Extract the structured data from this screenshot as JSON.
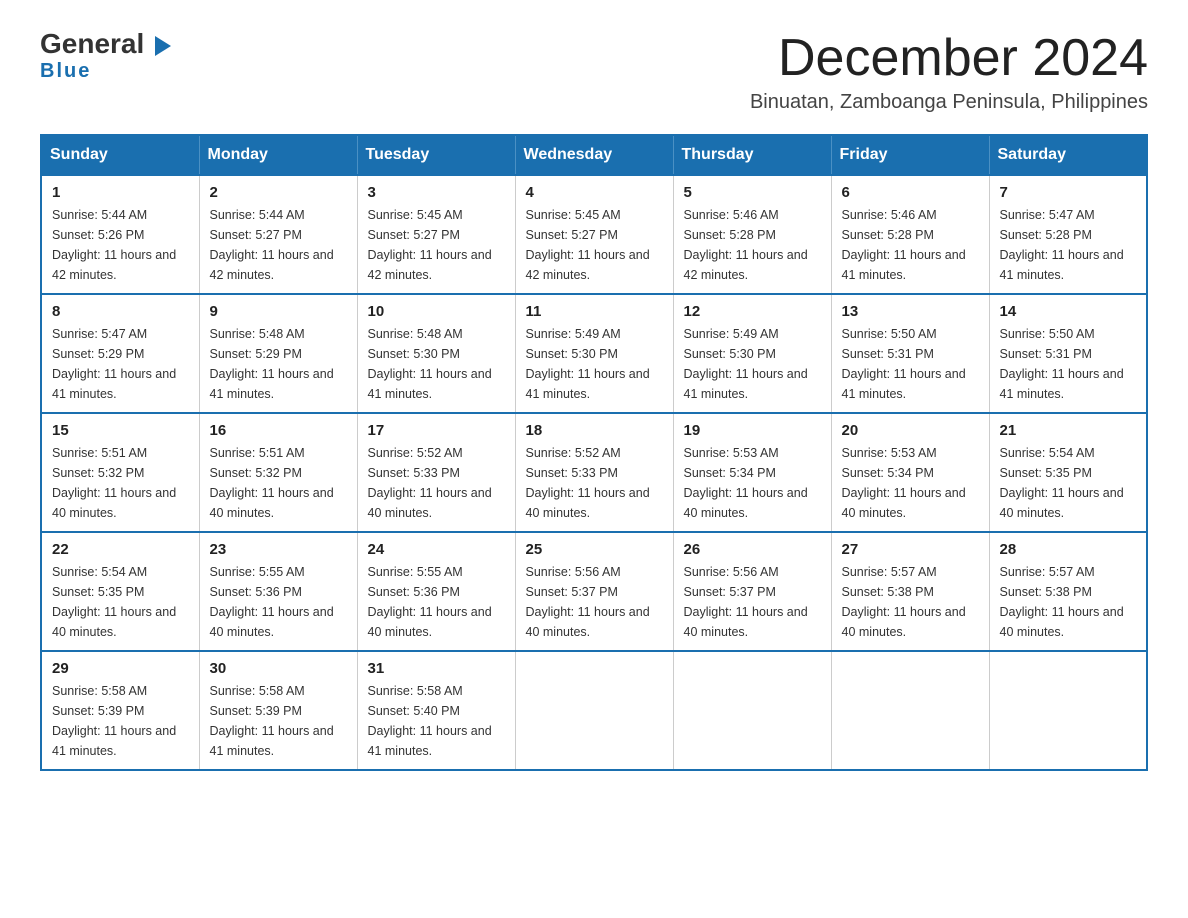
{
  "logo": {
    "general": "General",
    "blue": "Blue",
    "triangle_char": "▶"
  },
  "header": {
    "month_year": "December 2024",
    "location": "Binuatan, Zamboanga Peninsula, Philippines"
  },
  "weekdays": [
    "Sunday",
    "Monday",
    "Tuesday",
    "Wednesday",
    "Thursday",
    "Friday",
    "Saturday"
  ],
  "weeks": [
    [
      {
        "day": "1",
        "sunrise": "5:44 AM",
        "sunset": "5:26 PM",
        "daylight": "11 hours and 42 minutes."
      },
      {
        "day": "2",
        "sunrise": "5:44 AM",
        "sunset": "5:27 PM",
        "daylight": "11 hours and 42 minutes."
      },
      {
        "day": "3",
        "sunrise": "5:45 AM",
        "sunset": "5:27 PM",
        "daylight": "11 hours and 42 minutes."
      },
      {
        "day": "4",
        "sunrise": "5:45 AM",
        "sunset": "5:27 PM",
        "daylight": "11 hours and 42 minutes."
      },
      {
        "day": "5",
        "sunrise": "5:46 AM",
        "sunset": "5:28 PM",
        "daylight": "11 hours and 42 minutes."
      },
      {
        "day": "6",
        "sunrise": "5:46 AM",
        "sunset": "5:28 PM",
        "daylight": "11 hours and 41 minutes."
      },
      {
        "day": "7",
        "sunrise": "5:47 AM",
        "sunset": "5:28 PM",
        "daylight": "11 hours and 41 minutes."
      }
    ],
    [
      {
        "day": "8",
        "sunrise": "5:47 AM",
        "sunset": "5:29 PM",
        "daylight": "11 hours and 41 minutes."
      },
      {
        "day": "9",
        "sunrise": "5:48 AM",
        "sunset": "5:29 PM",
        "daylight": "11 hours and 41 minutes."
      },
      {
        "day": "10",
        "sunrise": "5:48 AM",
        "sunset": "5:30 PM",
        "daylight": "11 hours and 41 minutes."
      },
      {
        "day": "11",
        "sunrise": "5:49 AM",
        "sunset": "5:30 PM",
        "daylight": "11 hours and 41 minutes."
      },
      {
        "day": "12",
        "sunrise": "5:49 AM",
        "sunset": "5:30 PM",
        "daylight": "11 hours and 41 minutes."
      },
      {
        "day": "13",
        "sunrise": "5:50 AM",
        "sunset": "5:31 PM",
        "daylight": "11 hours and 41 minutes."
      },
      {
        "day": "14",
        "sunrise": "5:50 AM",
        "sunset": "5:31 PM",
        "daylight": "11 hours and 41 minutes."
      }
    ],
    [
      {
        "day": "15",
        "sunrise": "5:51 AM",
        "sunset": "5:32 PM",
        "daylight": "11 hours and 40 minutes."
      },
      {
        "day": "16",
        "sunrise": "5:51 AM",
        "sunset": "5:32 PM",
        "daylight": "11 hours and 40 minutes."
      },
      {
        "day": "17",
        "sunrise": "5:52 AM",
        "sunset": "5:33 PM",
        "daylight": "11 hours and 40 minutes."
      },
      {
        "day": "18",
        "sunrise": "5:52 AM",
        "sunset": "5:33 PM",
        "daylight": "11 hours and 40 minutes."
      },
      {
        "day": "19",
        "sunrise": "5:53 AM",
        "sunset": "5:34 PM",
        "daylight": "11 hours and 40 minutes."
      },
      {
        "day": "20",
        "sunrise": "5:53 AM",
        "sunset": "5:34 PM",
        "daylight": "11 hours and 40 minutes."
      },
      {
        "day": "21",
        "sunrise": "5:54 AM",
        "sunset": "5:35 PM",
        "daylight": "11 hours and 40 minutes."
      }
    ],
    [
      {
        "day": "22",
        "sunrise": "5:54 AM",
        "sunset": "5:35 PM",
        "daylight": "11 hours and 40 minutes."
      },
      {
        "day": "23",
        "sunrise": "5:55 AM",
        "sunset": "5:36 PM",
        "daylight": "11 hours and 40 minutes."
      },
      {
        "day": "24",
        "sunrise": "5:55 AM",
        "sunset": "5:36 PM",
        "daylight": "11 hours and 40 minutes."
      },
      {
        "day": "25",
        "sunrise": "5:56 AM",
        "sunset": "5:37 PM",
        "daylight": "11 hours and 40 minutes."
      },
      {
        "day": "26",
        "sunrise": "5:56 AM",
        "sunset": "5:37 PM",
        "daylight": "11 hours and 40 minutes."
      },
      {
        "day": "27",
        "sunrise": "5:57 AM",
        "sunset": "5:38 PM",
        "daylight": "11 hours and 40 minutes."
      },
      {
        "day": "28",
        "sunrise": "5:57 AM",
        "sunset": "5:38 PM",
        "daylight": "11 hours and 40 minutes."
      }
    ],
    [
      {
        "day": "29",
        "sunrise": "5:58 AM",
        "sunset": "5:39 PM",
        "daylight": "11 hours and 41 minutes."
      },
      {
        "day": "30",
        "sunrise": "5:58 AM",
        "sunset": "5:39 PM",
        "daylight": "11 hours and 41 minutes."
      },
      {
        "day": "31",
        "sunrise": "5:58 AM",
        "sunset": "5:40 PM",
        "daylight": "11 hours and 41 minutes."
      },
      null,
      null,
      null,
      null
    ]
  ],
  "labels": {
    "sunrise": "Sunrise:",
    "sunset": "Sunset:",
    "daylight": "Daylight:"
  }
}
